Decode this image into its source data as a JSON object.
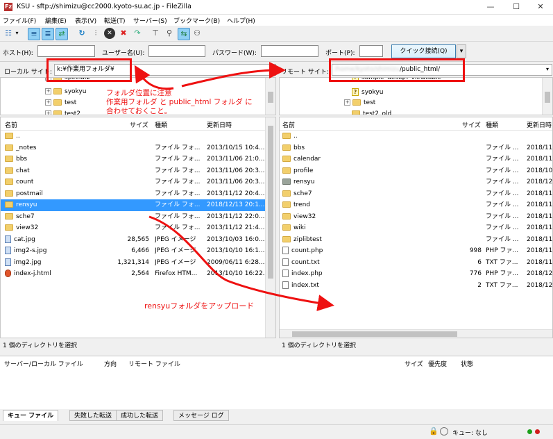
{
  "window": {
    "title": "KSU - sftp://shimizu@cc2000.kyoto-su.ac.jp - FileZilla",
    "app_icon": "Fz"
  },
  "menu": [
    "ファイル(F)",
    "編集(E)",
    "表示(V)",
    "転送(T)",
    "サーバー(S)",
    "ブックマーク(B)",
    "ヘルプ(H)"
  ],
  "quickconnect": {
    "host_label": "ホスト(H):",
    "user_label": "ユーザー名(U):",
    "password_label": "パスワード(W):",
    "port_label": "ポート(P):",
    "connect_button": "クイック接続(Q)",
    "dropdown_glyph": "▾"
  },
  "local": {
    "site_label": "ローカル サイト:",
    "path": "k:¥作業用フォルダ¥",
    "tree": [
      "special2",
      "syokyu",
      "test",
      "test2"
    ],
    "columns": [
      "名前",
      "サイズ",
      "種類",
      "更新日時"
    ],
    "files": [
      {
        "name": "..",
        "size": "",
        "type": "",
        "date": "",
        "icon": "folder"
      },
      {
        "name": "_notes",
        "size": "",
        "type": "ファイル フォ...",
        "date": "2013/10/15 10:4...",
        "icon": "folder"
      },
      {
        "name": "bbs",
        "size": "",
        "type": "ファイル フォ...",
        "date": "2013/11/06 21:0...",
        "icon": "folder"
      },
      {
        "name": "chat",
        "size": "",
        "type": "ファイル フォ...",
        "date": "2013/11/06 20:3...",
        "icon": "folder"
      },
      {
        "name": "count",
        "size": "",
        "type": "ファイル フォ...",
        "date": "2013/11/06 20:3...",
        "icon": "folder"
      },
      {
        "name": "postmail",
        "size": "",
        "type": "ファイル フォ...",
        "date": "2013/11/12 20:4...",
        "icon": "folder"
      },
      {
        "name": "rensyu",
        "size": "",
        "type": "ファイル フォ...",
        "date": "2018/12/13 20:1...",
        "icon": "folder"
      },
      {
        "name": "sche7",
        "size": "",
        "type": "ファイル フォ...",
        "date": "2013/11/12 22:0...",
        "icon": "folder"
      },
      {
        "name": "view32",
        "size": "",
        "type": "ファイル フォ...",
        "date": "2013/11/12 21:4...",
        "icon": "folder"
      },
      {
        "name": "cat.jpg",
        "size": "28,565",
        "type": "JPEG イメージ",
        "date": "2013/10/03 16:0...",
        "icon": "image"
      },
      {
        "name": "img2-s.jpg",
        "size": "6,466",
        "type": "JPEG イメージ",
        "date": "2013/10/10 16:1...",
        "icon": "image"
      },
      {
        "name": "img2.jpg",
        "size": "1,321,314",
        "type": "JPEG イメージ",
        "date": "2009/06/11 6:28...",
        "icon": "image"
      },
      {
        "name": "index-j.html",
        "size": "2,564",
        "type": "Firefox HTM...",
        "date": "2013/10/10 16:22...",
        "icon": "html"
      }
    ],
    "selected_index": 6,
    "status": "1 個のディレクトリを選択"
  },
  "remote": {
    "site_label": "リモート サイト:",
    "path_blurred": "/home/kyoto/shimizu",
    "path_visible": "/public_html/",
    "tree": [
      "sample_design_viewtable",
      "syokyu",
      "test",
      "test2_old"
    ],
    "tree_icons": [
      "question",
      "question",
      "folder",
      "folder"
    ],
    "columns": [
      "名前",
      "サイズ",
      "種類",
      "更新日時"
    ],
    "files": [
      {
        "name": "..",
        "size": "",
        "type": "",
        "date": "",
        "icon": "folder"
      },
      {
        "name": "bbs",
        "size": "",
        "type": "ファイル ...",
        "date": "2018/11",
        "icon": "folder"
      },
      {
        "name": "calendar",
        "size": "",
        "type": "ファイル ...",
        "date": "2018/11",
        "icon": "folder"
      },
      {
        "name": "profile",
        "size": "",
        "type": "ファイル ...",
        "date": "2018/10",
        "icon": "folder"
      },
      {
        "name": "rensyu",
        "size": "",
        "type": "ファイル ...",
        "date": "2018/12",
        "icon": "folder-gray"
      },
      {
        "name": "sche7",
        "size": "",
        "type": "ファイル ...",
        "date": "2018/11",
        "icon": "folder"
      },
      {
        "name": "trend",
        "size": "",
        "type": "ファイル ...",
        "date": "2018/11",
        "icon": "folder"
      },
      {
        "name": "view32",
        "size": "",
        "type": "ファイル ...",
        "date": "2018/11",
        "icon": "folder"
      },
      {
        "name": "wiki",
        "size": "",
        "type": "ファイル ...",
        "date": "2018/11",
        "icon": "folder"
      },
      {
        "name": "ziplibtest",
        "size": "",
        "type": "ファイル ...",
        "date": "2018/11",
        "icon": "folder"
      },
      {
        "name": "count.php",
        "size": "998",
        "type": "PHP ファ...",
        "date": "2018/11",
        "icon": "file"
      },
      {
        "name": "count.txt",
        "size": "6",
        "type": "TXT ファ...",
        "date": "2018/11",
        "icon": "file"
      },
      {
        "name": "index.php",
        "size": "776",
        "type": "PHP ファ...",
        "date": "2018/12",
        "icon": "file"
      },
      {
        "name": "index.txt",
        "size": "2",
        "type": "TXT ファ...",
        "date": "2018/12",
        "icon": "file"
      }
    ],
    "status": "1 個のディレクトリを選択"
  },
  "queue": {
    "columns": [
      "サーバー/ローカル ファイル",
      "方向",
      "リモート ファイル",
      "サイズ",
      "優先度",
      "状態"
    ],
    "tabs": [
      "キュー ファイル",
      "失敗した転送",
      "成功した転送",
      "メッセージ ログ"
    ]
  },
  "statusbar": {
    "queue_text": "キュー: なし"
  },
  "annotations": {
    "note1_line1": "フォルダ位置に注意",
    "note1_line2": "作業用フォルダ と public_html フォルダ に",
    "note1_line3": "合わせておくこと。",
    "note2": "rensyuフォルダをアップロード",
    "color": "#ee1111"
  }
}
